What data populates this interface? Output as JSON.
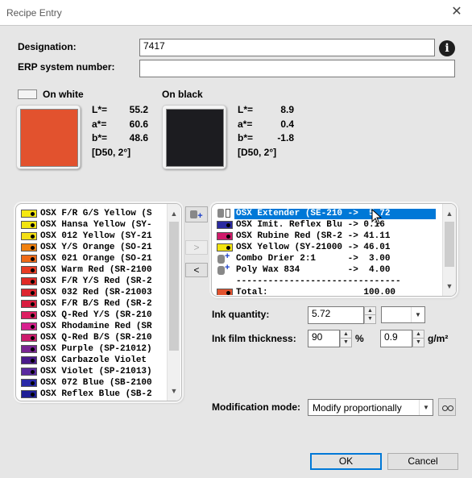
{
  "window": {
    "title": "Recipe Entry",
    "close": "✕"
  },
  "form": {
    "designation_label": "Designation:",
    "designation_value": "7417",
    "erp_label": "ERP system number:",
    "erp_value": "",
    "info": "i"
  },
  "on_white": {
    "label": "On white",
    "color": "#e2522e",
    "L": "55.2",
    "a": "60.6",
    "b": "48.6",
    "cond": "[D50, 2°]"
  },
  "on_black": {
    "label": "On black",
    "color": "#1c1c20",
    "L": "8.9",
    "a": "0.4",
    "b": "-1.8",
    "cond": "[D50, 2°]"
  },
  "lab_keys": {
    "L": "L*=",
    "a": "a*=",
    "b": "b*="
  },
  "available_inks": [
    {
      "text": "OSX F/R G/S Yellow (S",
      "color": "#f5e812"
    },
    {
      "text": "OSX Hansa Yellow (SY-",
      "color": "#f2e40f"
    },
    {
      "text": "OSX 012 Yellow (SY-21",
      "color": "#f3df16"
    },
    {
      "text": "OSX Y/S Orange (SO-21",
      "color": "#f08010"
    },
    {
      "text": "OSX 021 Orange (SO-21",
      "color": "#ef6a17"
    },
    {
      "text": "OSX Warm Red (SR-2100",
      "color": "#e83b24"
    },
    {
      "text": "OSX F/R Y/S Red (SR-2",
      "color": "#e02a26"
    },
    {
      "text": "OSX 032 Red (SR-21003",
      "color": "#dd2530"
    },
    {
      "text": "OSX F/R B/S Red (SR-2",
      "color": "#d81d40"
    },
    {
      "text": "OSX Q-Red Y/S (SR-210",
      "color": "#dc1f62"
    },
    {
      "text": "OSX Rhodamine Red (SR",
      "color": "#d8208f"
    },
    {
      "text": "OSX Q-Red B/S (SR-210",
      "color": "#cc1c6c"
    },
    {
      "text": "OSX Purple (SP-21012)",
      "color": "#7a2592"
    },
    {
      "text": "OSX Carbazole Violet ",
      "color": "#4a1a8a"
    },
    {
      "text": "OSX Violet (SP-21013)",
      "color": "#5a2aa0"
    },
    {
      "text": "OSX 072 Blue (SB-2100",
      "color": "#2a2aa8"
    },
    {
      "text": "OSX Reflex Blue (SB-2",
      "color": "#1f1f96"
    }
  ],
  "recipe_rows": [
    {
      "text": "OSX Extender (SE-210 ->  5.72",
      "icon": "drum"
    },
    {
      "text": "OSX Imit. Reflex Blu -> 0.16",
      "color": "#2a2aa0"
    },
    {
      "text": "OSX Rubine Red (SR-2 -> 41.11",
      "color": "#d01a6a"
    },
    {
      "text": "OSX Yellow (SY-21000 -> 46.01",
      "color": "#f2e40f"
    },
    {
      "text": "Combo Drier 2:1      ->  3.00",
      "icon": "additive"
    },
    {
      "text": "Poly Wax 834         ->  4.00",
      "icon": "additive"
    },
    {
      "text": "-------------------------------",
      "icon": "none"
    },
    {
      "text": "Total:                  100.00",
      "color": "#e2522e"
    }
  ],
  "transfer": {
    "add_icon": "+",
    "right": ">",
    "left": "<"
  },
  "ink_quantity": {
    "label": "Ink quantity:",
    "value": "5.72",
    "unit": ""
  },
  "ink_film": {
    "label": "Ink film thickness:",
    "percent": "90",
    "percent_unit": "%",
    "gsm": "0.9",
    "gsm_unit": "g/m²"
  },
  "modification": {
    "label": "Modification mode:",
    "value": "Modify proportionally"
  },
  "buttons": {
    "ok": "OK",
    "cancel": "Cancel"
  }
}
